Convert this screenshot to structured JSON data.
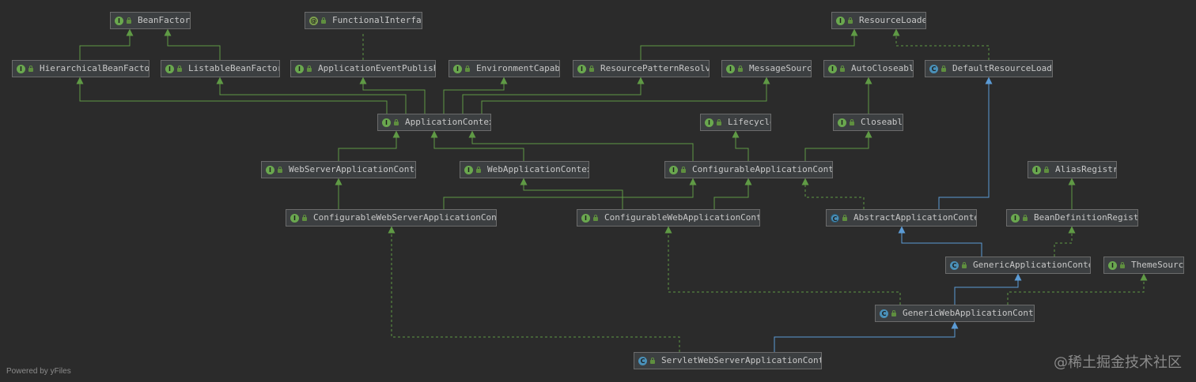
{
  "colors": {
    "background": "#2b2b2b",
    "interface_badge": "#6aa84f",
    "class_badge": "#4a90b8",
    "annotation_badge": "#7fa34f",
    "extends_edge": "#5f9a45",
    "class_extends_edge": "#5b9bd5"
  },
  "nodes": [
    {
      "id": "BeanFactory",
      "label": "BeanFactory",
      "kind": "interface",
      "badge": "I",
      "icon": "interface-icon"
    },
    {
      "id": "FunctionalInterface",
      "label": "FunctionalInterface",
      "kind": "annotation",
      "badge": "@",
      "icon": "annotation-icon"
    },
    {
      "id": "ResourceLoader",
      "label": "ResourceLoader",
      "kind": "interface",
      "badge": "I",
      "icon": "interface-icon"
    },
    {
      "id": "HierarchicalBeanFactory",
      "label": "HierarchicalBeanFactory",
      "kind": "interface",
      "badge": "I",
      "icon": "interface-icon"
    },
    {
      "id": "ListableBeanFactory",
      "label": "ListableBeanFactory",
      "kind": "interface",
      "badge": "I",
      "icon": "interface-icon"
    },
    {
      "id": "ApplicationEventPublisher",
      "label": "ApplicationEventPublisher",
      "kind": "interface",
      "badge": "I",
      "icon": "interface-icon"
    },
    {
      "id": "EnvironmentCapable",
      "label": "EnvironmentCapable",
      "kind": "interface",
      "badge": "I",
      "icon": "interface-icon"
    },
    {
      "id": "ResourcePatternResolver",
      "label": "ResourcePatternResolver",
      "kind": "interface",
      "badge": "I",
      "icon": "interface-icon"
    },
    {
      "id": "MessageSource",
      "label": "MessageSource",
      "kind": "interface",
      "badge": "I",
      "icon": "interface-icon"
    },
    {
      "id": "AutoCloseable",
      "label": "AutoCloseable",
      "kind": "interface",
      "badge": "I",
      "icon": "interface-icon"
    },
    {
      "id": "DefaultResourceLoader",
      "label": "DefaultResourceLoader",
      "kind": "class",
      "badge": "C",
      "icon": "class-icon"
    },
    {
      "id": "ApplicationContext",
      "label": "ApplicationContext",
      "kind": "interface",
      "badge": "I",
      "icon": "interface-icon"
    },
    {
      "id": "Lifecycle",
      "label": "Lifecycle",
      "kind": "interface",
      "badge": "I",
      "icon": "interface-icon"
    },
    {
      "id": "Closeable",
      "label": "Closeable",
      "kind": "interface",
      "badge": "I",
      "icon": "interface-icon"
    },
    {
      "id": "WebServerApplicationContext",
      "label": "WebServerApplicationContext",
      "kind": "interface",
      "badge": "I",
      "icon": "interface-icon"
    },
    {
      "id": "WebApplicationContext",
      "label": "WebApplicationContext",
      "kind": "interface",
      "badge": "I",
      "icon": "interface-icon"
    },
    {
      "id": "ConfigurableApplicationContext",
      "label": "ConfigurableApplicationContext",
      "kind": "interface",
      "badge": "I",
      "icon": "interface-icon"
    },
    {
      "id": "AliasRegistry",
      "label": "AliasRegistry",
      "kind": "interface",
      "badge": "I",
      "icon": "interface-icon"
    },
    {
      "id": "ConfigurableWebServerApplicationContext",
      "label": "ConfigurableWebServerApplicationContext",
      "kind": "interface",
      "badge": "I",
      "icon": "interface-icon"
    },
    {
      "id": "ConfigurableWebApplicationContext",
      "label": "ConfigurableWebApplicationContext",
      "kind": "interface",
      "badge": "I",
      "icon": "interface-icon"
    },
    {
      "id": "AbstractApplicationContext",
      "label": "AbstractApplicationContext",
      "kind": "abstract",
      "badge": "C",
      "icon": "abstract-class-icon"
    },
    {
      "id": "BeanDefinitionRegistry",
      "label": "BeanDefinitionRegistry",
      "kind": "interface",
      "badge": "I",
      "icon": "interface-icon"
    },
    {
      "id": "GenericApplicationContext",
      "label": "GenericApplicationContext",
      "kind": "class",
      "badge": "C",
      "icon": "class-icon"
    },
    {
      "id": "ThemeSource",
      "label": "ThemeSource",
      "kind": "interface",
      "badge": "I",
      "icon": "interface-icon"
    },
    {
      "id": "GenericWebApplicationContext",
      "label": "GenericWebApplicationContext",
      "kind": "class",
      "badge": "C",
      "icon": "class-icon"
    },
    {
      "id": "ServletWebServerApplicationContext",
      "label": "ServletWebServerApplicationContext",
      "kind": "class",
      "badge": "C",
      "icon": "class-icon"
    }
  ],
  "edges": [
    {
      "from": "HierarchicalBeanFactory",
      "to": "BeanFactory",
      "type": "extends"
    },
    {
      "from": "ListableBeanFactory",
      "to": "BeanFactory",
      "type": "extends"
    },
    {
      "from": "ApplicationEventPublisher",
      "to": "FunctionalInterface",
      "type": "annotated"
    },
    {
      "from": "ResourcePatternResolver",
      "to": "ResourceLoader",
      "type": "extends"
    },
    {
      "from": "DefaultResourceLoader",
      "to": "ResourceLoader",
      "type": "implements"
    },
    {
      "from": "ApplicationContext",
      "to": "HierarchicalBeanFactory",
      "type": "extends"
    },
    {
      "from": "ApplicationContext",
      "to": "ListableBeanFactory",
      "type": "extends"
    },
    {
      "from": "ApplicationContext",
      "to": "ApplicationEventPublisher",
      "type": "extends"
    },
    {
      "from": "ApplicationContext",
      "to": "EnvironmentCapable",
      "type": "extends"
    },
    {
      "from": "ApplicationContext",
      "to": "ResourcePatternResolver",
      "type": "extends"
    },
    {
      "from": "ApplicationContext",
      "to": "MessageSource",
      "type": "extends"
    },
    {
      "from": "Closeable",
      "to": "AutoCloseable",
      "type": "extends"
    },
    {
      "from": "WebServerApplicationContext",
      "to": "ApplicationContext",
      "type": "extends"
    },
    {
      "from": "WebApplicationContext",
      "to": "ApplicationContext",
      "type": "extends"
    },
    {
      "from": "ConfigurableApplicationContext",
      "to": "ApplicationContext",
      "type": "extends"
    },
    {
      "from": "ConfigurableApplicationContext",
      "to": "Lifecycle",
      "type": "extends"
    },
    {
      "from": "ConfigurableApplicationContext",
      "to": "Closeable",
      "type": "extends"
    },
    {
      "from": "ConfigurableWebServerApplicationContext",
      "to": "WebServerApplicationContext",
      "type": "extends"
    },
    {
      "from": "ConfigurableWebServerApplicationContext",
      "to": "ConfigurableApplicationContext",
      "type": "extends"
    },
    {
      "from": "ConfigurableWebApplicationContext",
      "to": "WebApplicationContext",
      "type": "extends"
    },
    {
      "from": "ConfigurableWebApplicationContext",
      "to": "ConfigurableApplicationContext",
      "type": "extends"
    },
    {
      "from": "AbstractApplicationContext",
      "to": "ConfigurableApplicationContext",
      "type": "implements"
    },
    {
      "from": "AbstractApplicationContext",
      "to": "DefaultResourceLoader",
      "type": "class-extends"
    },
    {
      "from": "BeanDefinitionRegistry",
      "to": "AliasRegistry",
      "type": "extends"
    },
    {
      "from": "GenericApplicationContext",
      "to": "AbstractApplicationContext",
      "type": "class-extends"
    },
    {
      "from": "GenericApplicationContext",
      "to": "BeanDefinitionRegistry",
      "type": "implements"
    },
    {
      "from": "GenericWebApplicationContext",
      "to": "GenericApplicationContext",
      "type": "class-extends"
    },
    {
      "from": "GenericWebApplicationContext",
      "to": "ConfigurableWebApplicationContext",
      "type": "implements"
    },
    {
      "from": "GenericWebApplicationContext",
      "to": "ThemeSource",
      "type": "implements"
    },
    {
      "from": "ServletWebServerApplicationContext",
      "to": "GenericWebApplicationContext",
      "type": "class-extends"
    },
    {
      "from": "ServletWebServerApplicationContext",
      "to": "ConfigurableWebServerApplicationContext",
      "type": "implements"
    }
  ],
  "footer": "Powered by yFiles",
  "watermark": "@稀土掘金技术社区"
}
